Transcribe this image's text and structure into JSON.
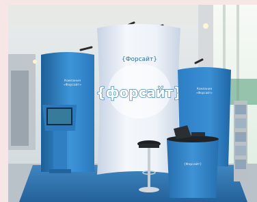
{
  "photo": {
    "subject": "Exhibition stand"
  },
  "backwall": {
    "small_logo_text": "{Форсайт}",
    "big_logo_text": "{форсайт}"
  },
  "left_panel": {
    "text_line1": "Компания",
    "text_line2": "«Форсайт»"
  },
  "right_panel": {
    "text_line1": "Компания",
    "text_line2": "«Форсайт»"
  },
  "counter": {
    "logo_text": "{Форсайт}"
  },
  "colors": {
    "frame_border": "#f6e6e6",
    "backwall": "#eef2f8",
    "panel_blue": "#2f7fc2",
    "floor_blue": "#2f6fa6",
    "wall": "#dfe5e9"
  }
}
